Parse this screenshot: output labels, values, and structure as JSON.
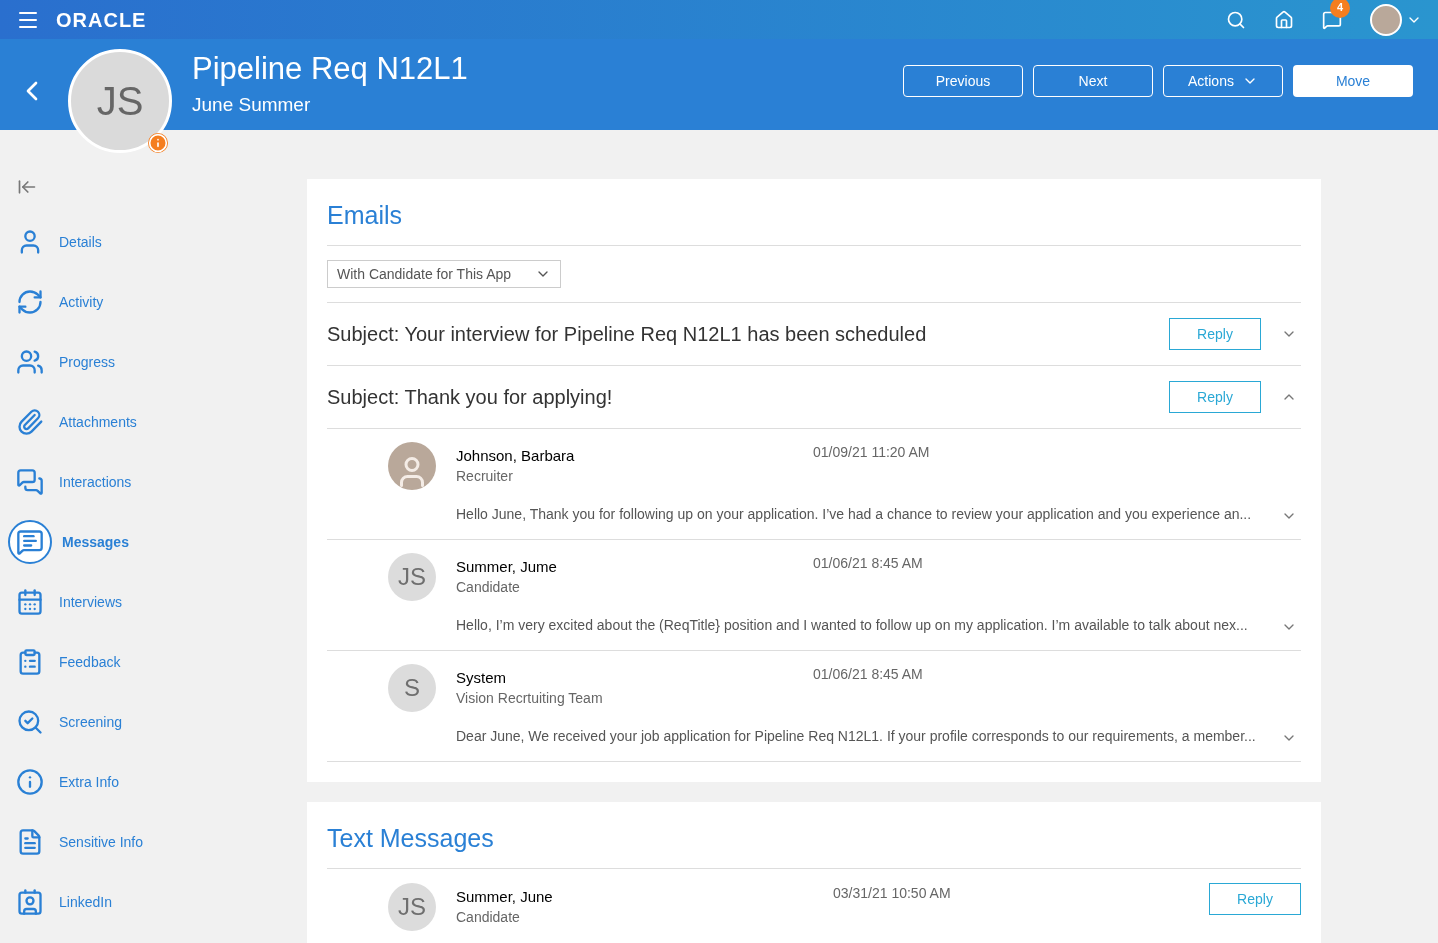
{
  "topbar": {
    "logo": "ORACLE",
    "notification_count": "4"
  },
  "header": {
    "title": "Pipeline Req N12L1",
    "subtitle": "June Summer",
    "avatar_initials": "JS",
    "buttons": [
      {
        "label": "Previous",
        "kind": "outline"
      },
      {
        "label": "Next",
        "kind": "outline"
      },
      {
        "label": "Actions",
        "kind": "menu"
      },
      {
        "label": "Move",
        "kind": "primary"
      }
    ]
  },
  "sidebar": {
    "items": [
      {
        "label": "Details",
        "selected": false
      },
      {
        "label": "Activity",
        "selected": false
      },
      {
        "label": "Progress",
        "selected": false
      },
      {
        "label": "Attachments",
        "selected": false
      },
      {
        "label": "Interactions",
        "selected": false
      },
      {
        "label": "Messages",
        "selected": true
      },
      {
        "label": "Interviews",
        "selected": false
      },
      {
        "label": "Feedback",
        "selected": false
      },
      {
        "label": "Screening",
        "selected": false
      },
      {
        "label": "Extra Info",
        "selected": false
      },
      {
        "label": "Sensitive Info",
        "selected": false
      },
      {
        "label": "LinkedIn",
        "selected": false
      }
    ]
  },
  "emails": {
    "title": "Emails",
    "filter": "With Candidate for This App",
    "threads": [
      {
        "subject": "Subject: Your interview for Pipeline Req N12L1 has been scheduled",
        "reply": "Reply",
        "expanded": false
      },
      {
        "subject": "Subject: Thank you for applying!",
        "reply": "Reply",
        "expanded": true,
        "messages": [
          {
            "name": "Johnson, Barbara",
            "role": "Recruiter",
            "date": "01/09/21 11:20 AM",
            "body": "Hello June, Thank you for following up on your application. I’ve had a chance to review your application and you experience an...",
            "kind": "photo"
          },
          {
            "name": "Summer, Jume",
            "role": "Candidate",
            "date": "01/06/21 8:45 AM",
            "body": "Hello, I’m very excited about the (ReqTitle} position and I wanted to follow up  on my application. I’m available to talk about nex...",
            "kind": "initials",
            "initials": "JS"
          },
          {
            "name": "System",
            "role": "Vision Recrtuiting Team",
            "date": "01/06/21 8:45 AM",
            "body": "Dear June, We received your job application for Pipeline Req N12L1. If your profile corresponds to our requirements, a member...",
            "kind": "initials",
            "initials": "S"
          }
        ]
      }
    ]
  },
  "text_messages": {
    "title": "Text Messages",
    "messages": [
      {
        "name": "Summer, June",
        "role": "Candidate",
        "date": "03/31/21 10:50 AM",
        "reply": "Reply",
        "kind": "initials",
        "initials": "JS"
      }
    ]
  }
}
